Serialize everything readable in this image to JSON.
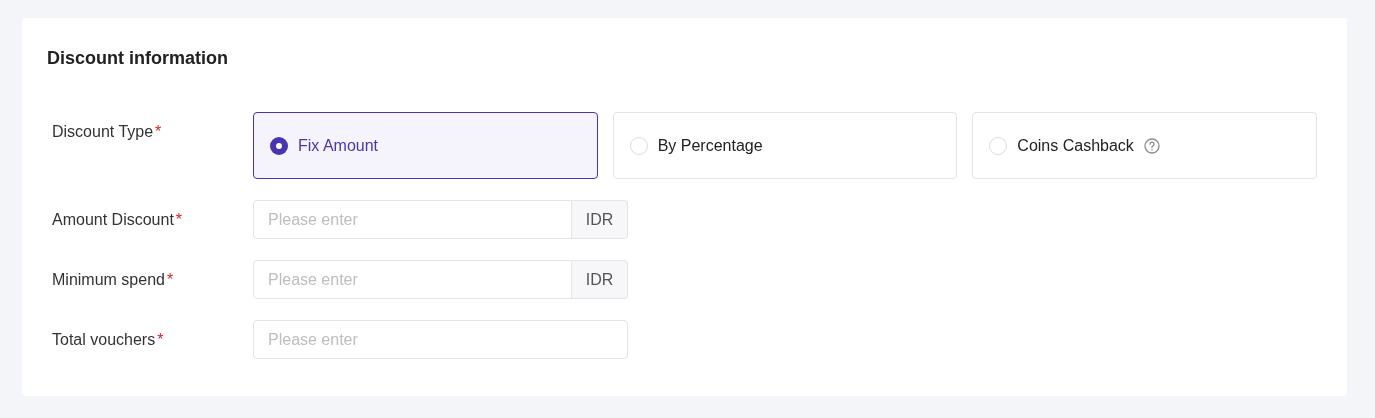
{
  "section": {
    "title": "Discount information"
  },
  "discount_type": {
    "label": "Discount Type",
    "required_mark": "*",
    "options": [
      {
        "label": "Fix Amount",
        "selected": true,
        "help": false
      },
      {
        "label": "By Percentage",
        "selected": false,
        "help": false
      },
      {
        "label": "Coins Cashback",
        "selected": false,
        "help": true
      }
    ]
  },
  "fields": [
    {
      "label": "Amount Discount",
      "required_mark": "*",
      "placeholder": "Please enter",
      "suffix": "IDR"
    },
    {
      "label": "Minimum spend",
      "required_mark": "*",
      "placeholder": "Please enter",
      "suffix": "IDR"
    },
    {
      "label": "Total vouchers",
      "required_mark": "*",
      "placeholder": "Please enter"
    }
  ]
}
